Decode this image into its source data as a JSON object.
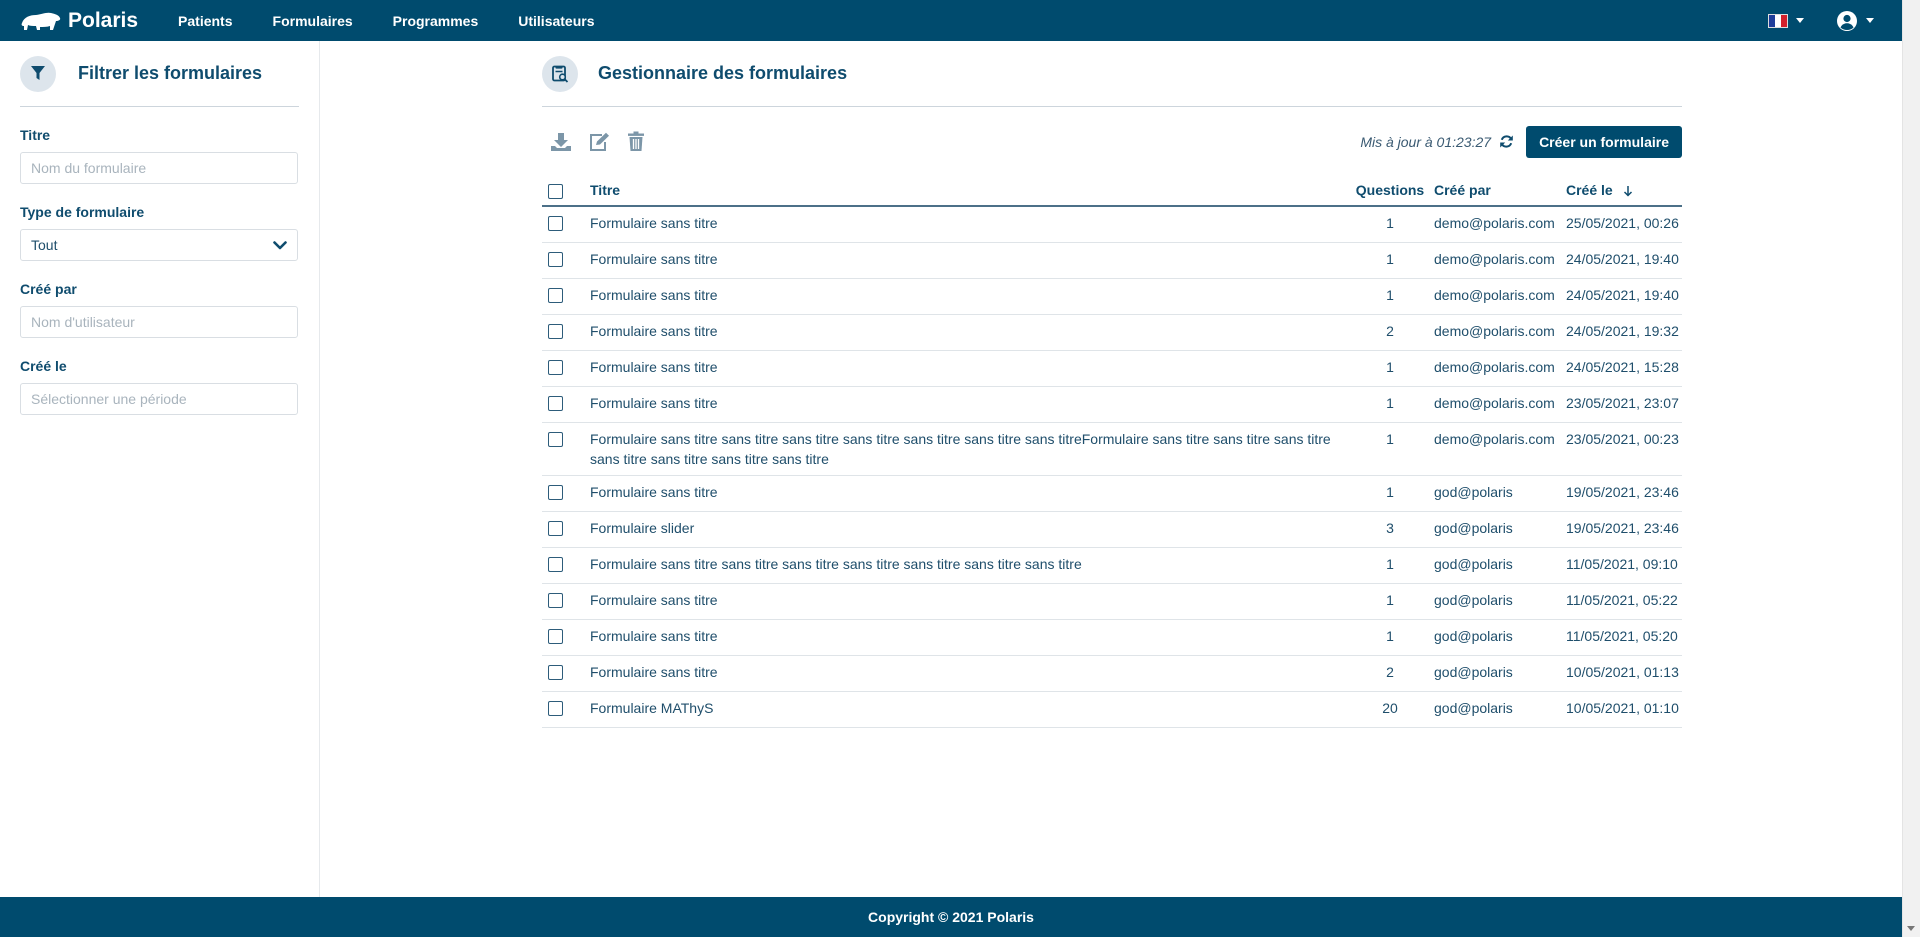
{
  "nav": {
    "brand": "Polaris",
    "links": [
      "Patients",
      "Formulaires",
      "Programmes",
      "Utilisateurs"
    ],
    "flag_colors": [
      "#1f3d9a",
      "#ffffff",
      "#d3212c"
    ]
  },
  "sidebar": {
    "title": "Filtrer les formulaires",
    "filters": {
      "title_label": "Titre",
      "title_placeholder": "Nom du formulaire",
      "type_label": "Type de formulaire",
      "type_value": "Tout",
      "created_by_label": "Créé par",
      "created_by_placeholder": "Nom d'utilisateur",
      "created_on_label": "Créé le",
      "created_on_placeholder": "Sélectionner une période"
    }
  },
  "main": {
    "title": "Gestionnaire des formulaires",
    "updated_text": "Mis à jour à 01:23:27",
    "create_button": "Créer un formulaire",
    "columns": {
      "title": "Titre",
      "questions": "Questions",
      "created_by": "Créé par",
      "created_on": "Créé le"
    },
    "rows": [
      {
        "title": "Formulaire sans titre",
        "questions": "1",
        "created_by": "demo@polaris.com",
        "created_on": "25/05/2021, 00:26"
      },
      {
        "title": "Formulaire sans titre",
        "questions": "1",
        "created_by": "demo@polaris.com",
        "created_on": "24/05/2021, 19:40"
      },
      {
        "title": "Formulaire sans titre",
        "questions": "1",
        "created_by": "demo@polaris.com",
        "created_on": "24/05/2021, 19:40"
      },
      {
        "title": "Formulaire sans titre",
        "questions": "2",
        "created_by": "demo@polaris.com",
        "created_on": "24/05/2021, 19:32"
      },
      {
        "title": "Formulaire sans titre",
        "questions": "1",
        "created_by": "demo@polaris.com",
        "created_on": "24/05/2021, 15:28"
      },
      {
        "title": "Formulaire sans titre",
        "questions": "1",
        "created_by": "demo@polaris.com",
        "created_on": "23/05/2021, 23:07"
      },
      {
        "title": "Formulaire sans titre sans titre sans titre sans titre sans titre sans titre sans titreFormulaire sans titre sans titre sans titre sans titre sans titre sans titre sans titre",
        "questions": "1",
        "created_by": "demo@polaris.com",
        "created_on": "23/05/2021, 00:23"
      },
      {
        "title": "Formulaire sans titre",
        "questions": "1",
        "created_by": "god@polaris",
        "created_on": "19/05/2021, 23:46"
      },
      {
        "title": "Formulaire slider",
        "questions": "3",
        "created_by": "god@polaris",
        "created_on": "19/05/2021, 23:46"
      },
      {
        "title": "Formulaire sans titre sans titre sans titre sans titre sans titre sans titre sans titre",
        "questions": "1",
        "created_by": "god@polaris",
        "created_on": "11/05/2021, 09:10"
      },
      {
        "title": "Formulaire sans titre",
        "questions": "1",
        "created_by": "god@polaris",
        "created_on": "11/05/2021, 05:22"
      },
      {
        "title": "Formulaire sans titre",
        "questions": "1",
        "created_by": "god@polaris",
        "created_on": "11/05/2021, 05:20"
      },
      {
        "title": "Formulaire sans titre",
        "questions": "2",
        "created_by": "god@polaris",
        "created_on": "10/05/2021, 01:13"
      },
      {
        "title": "Formulaire MAThyS",
        "questions": "20",
        "created_by": "god@polaris",
        "created_on": "10/05/2021, 01:10"
      }
    ]
  },
  "footer": {
    "copyright": "Copyright © 2021 Polaris"
  }
}
